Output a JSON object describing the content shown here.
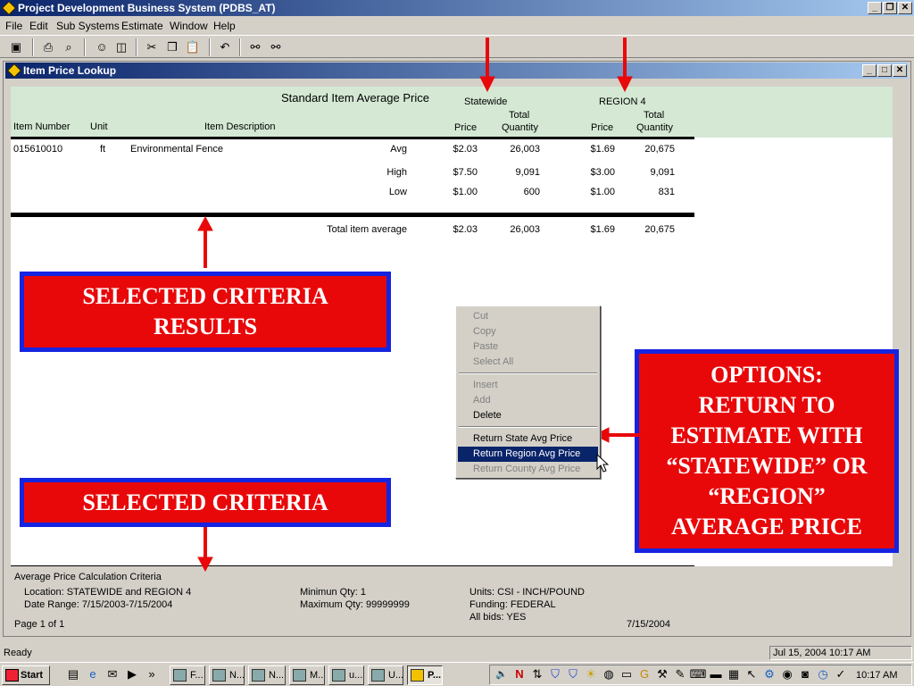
{
  "app": {
    "title": "Project Development Business System (PDBS_AT)",
    "menu": [
      "File",
      "Edit",
      "Sub Systems",
      "Estimate",
      "Window",
      "Help"
    ],
    "toolbar_icons": [
      "save-icon",
      "print-icon",
      "print-preview-icon",
      "find-user-icon",
      "columns-icon",
      "cut-icon",
      "copy-icon",
      "paste-icon",
      "undo-icon",
      "binoculars-icon",
      "binoculars-settings-icon"
    ]
  },
  "child": {
    "title": "Item Price Lookup"
  },
  "report": {
    "title": "Standard Item Average Price",
    "group1": "Statewide",
    "group2": "REGION 4",
    "col_item_number": "Item Number",
    "col_unit": "Unit",
    "col_description": "Item Description",
    "col_price": "Price",
    "col_total": "Total",
    "col_quantity": "Quantity",
    "item": {
      "number": "015610010",
      "unit": "ft",
      "description": "Environmental Fence"
    },
    "rows": [
      {
        "label": "Avg",
        "s_price": "$2.03",
        "s_qty": "26,003",
        "r_price": "$1.69",
        "r_qty": "20,675"
      },
      {
        "label": "High",
        "s_price": "$7.50",
        "s_qty": "9,091",
        "r_price": "$3.00",
        "r_qty": "9,091"
      },
      {
        "label": "Low",
        "s_price": "$1.00",
        "s_qty": "600",
        "r_price": "$1.00",
        "r_qty": "831"
      }
    ],
    "total": {
      "label": "Total item average",
      "s_price": "$2.03",
      "s_qty": "26,003",
      "r_price": "$1.69",
      "r_qty": "20,675"
    }
  },
  "footer": {
    "heading": "Average Price Calculation Criteria",
    "location": "Location: STATEWIDE and REGION 4",
    "date_range": "Date Range: 7/15/2003-7/15/2004",
    "min_qty": "Minimun Qty: 1",
    "max_qty": "Maximum Qty: 99999999",
    "units": "Units: CSI - INCH/POUND",
    "funding": "Funding: FEDERAL",
    "all_bids": "All bids: YES",
    "page": "Page 1 of 1",
    "date": "7/15/2004"
  },
  "callouts": {
    "results_line1": "SELECTED CRITERIA",
    "results_line2": "RESULTS",
    "criteria": "SELECTED CRITERIA",
    "options_lines": [
      "OPTIONS:",
      "RETURN TO",
      "ESTIMATE WITH",
      "“STATEWIDE” OR",
      "“REGION”",
      "AVERAGE PRICE"
    ]
  },
  "context_menu": {
    "cut": "Cut",
    "copy": "Copy",
    "paste": "Paste",
    "select_all": "Select All",
    "insert": "Insert",
    "add": "Add",
    "delete": "Delete",
    "return_state": "Return State Avg Price",
    "return_region": "Return Region Avg Price",
    "return_county": "Return County Avg Price"
  },
  "status": {
    "text": "Ready",
    "datetime": "Jul 15, 2004 10:17 AM"
  },
  "taskbar": {
    "start": "Start",
    "buttons": [
      "F...",
      "N...",
      "N...",
      "M...",
      "u...",
      "U...",
      "P..."
    ],
    "clock": "10:17 AM"
  },
  "colors": {
    "titlebar": "#0a246a",
    "callout_red": "#e8080a",
    "callout_border": "#1424e0",
    "header_green": "#d4e8d4",
    "selection": "#0a246a"
  }
}
